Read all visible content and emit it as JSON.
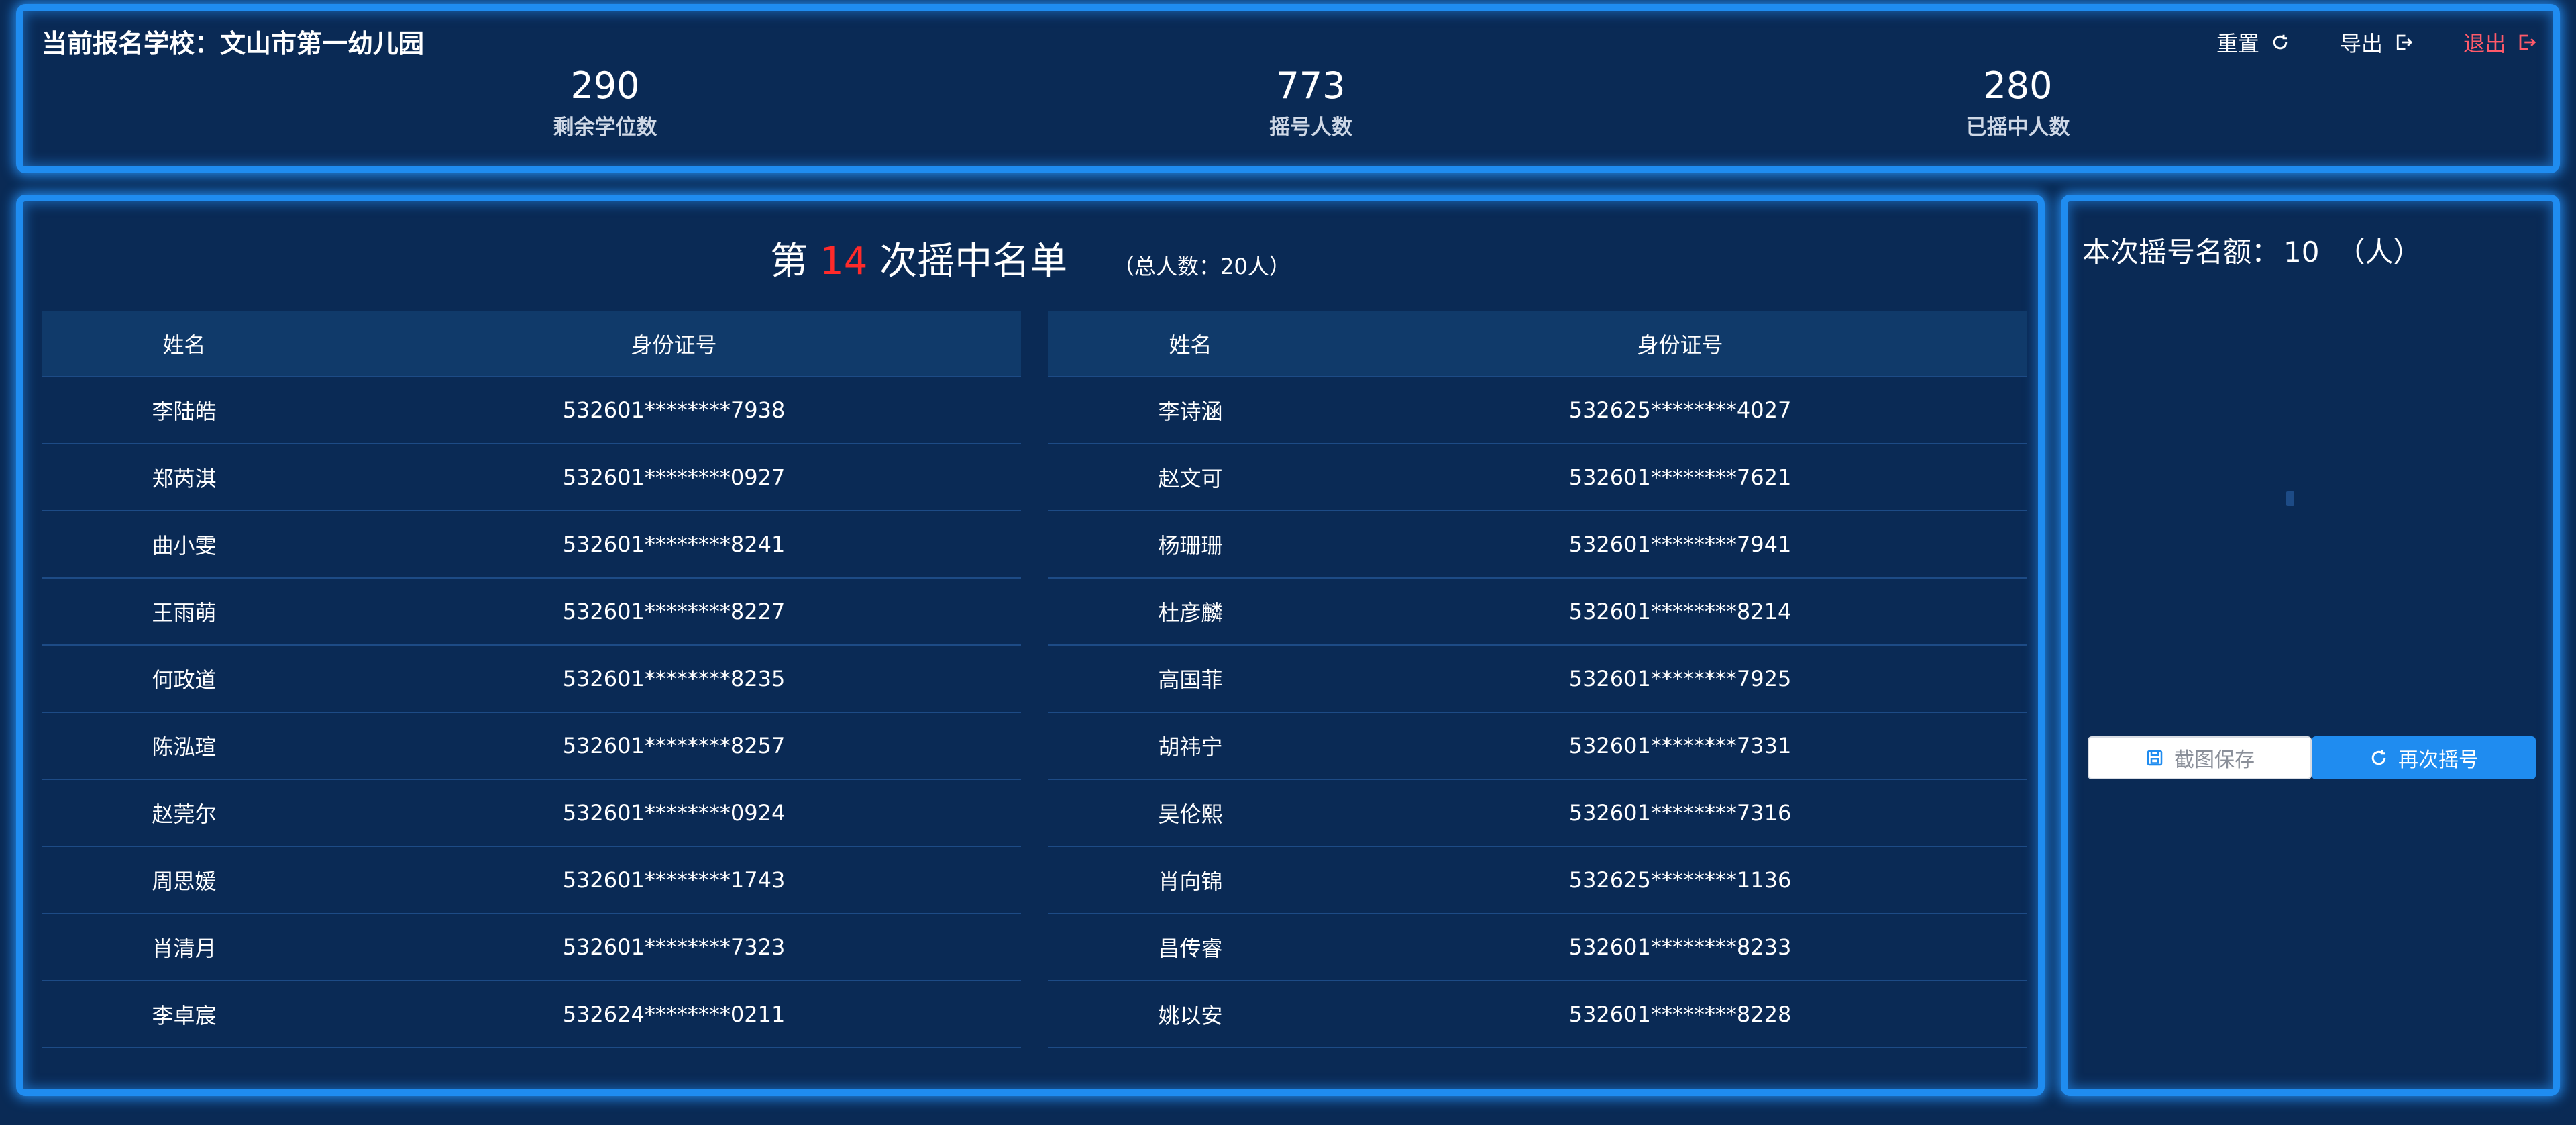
{
  "header": {
    "school_label": "当前报名学校：文山市第一幼儿园",
    "actions": {
      "reset": "重置",
      "export": "导出",
      "logout": "退出"
    }
  },
  "stats": [
    {
      "value": "290",
      "label": "剩余学位数"
    },
    {
      "value": "773",
      "label": "摇号人数"
    },
    {
      "value": "280",
      "label": "已摇中人数"
    }
  ],
  "list": {
    "title_prefix": "第",
    "round": "14",
    "title_suffix": "次摇中名单",
    "total": "（总人数：20人）",
    "columns": {
      "name": "姓名",
      "id": "身份证号"
    },
    "left_rows": [
      {
        "name": "李陆皓",
        "id": "532601********7938"
      },
      {
        "name": "郑芮淇",
        "id": "532601********0927"
      },
      {
        "name": "曲小雯",
        "id": "532601********8241"
      },
      {
        "name": "王雨萌",
        "id": "532601********8227"
      },
      {
        "name": "何政道",
        "id": "532601********8235"
      },
      {
        "name": "陈泓瑄",
        "id": "532601********8257"
      },
      {
        "name": "赵莞尔",
        "id": "532601********0924"
      },
      {
        "name": "周思媛",
        "id": "532601********1743"
      },
      {
        "name": "肖清月",
        "id": "532601********7323"
      },
      {
        "name": "李卓宸",
        "id": "532624********0211"
      }
    ],
    "right_rows": [
      {
        "name": "李诗涵",
        "id": "532625********4027"
      },
      {
        "name": "赵文可",
        "id": "532601********7621"
      },
      {
        "name": "杨珊珊",
        "id": "532601********7941"
      },
      {
        "name": "杜彦麟",
        "id": "532601********8214"
      },
      {
        "name": "高国菲",
        "id": "532601********7925"
      },
      {
        "name": "胡祎宁",
        "id": "532601********7331"
      },
      {
        "name": "吴伦熙",
        "id": "532601********7316"
      },
      {
        "name": "肖向锦",
        "id": "532625********1136"
      },
      {
        "name": "昌传睿",
        "id": "532601********8233"
      },
      {
        "name": "姚以安",
        "id": "532601********8228"
      }
    ]
  },
  "side": {
    "quota_label": "本次摇号名额：",
    "quota_value": "10",
    "quota_unit": "（人）",
    "save_button": "截图保存",
    "again_button": "再次摇号"
  },
  "colors": {
    "background": "#0a2a55",
    "panel_border": "#1f8cf0",
    "round_highlight": "#ff2a2a",
    "logout": "#ff5a6a",
    "table_header": "#103a6a"
  }
}
